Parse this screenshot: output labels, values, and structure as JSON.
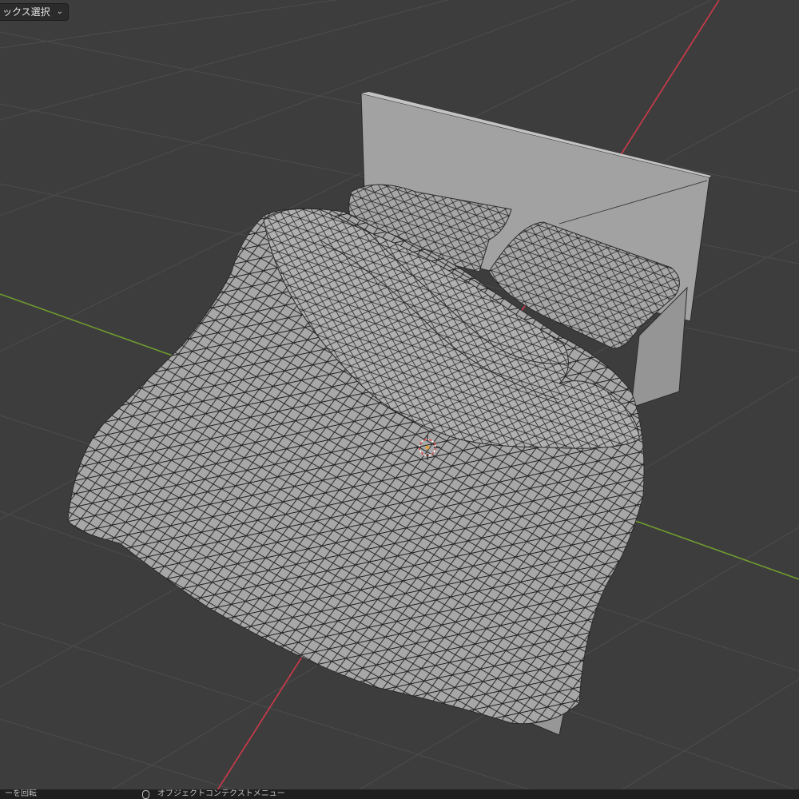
{
  "header": {
    "select_mode_label": "ックス選択",
    "chevron_icon": "chevron-down-icon"
  },
  "viewport": {
    "background_color": "#3d3d3d",
    "grid_color": "#4a4a4a",
    "x_axis_color": "#cf3a4a",
    "y_axis_color": "#6f9a2f",
    "mesh_color": "#a5a5a5",
    "wire_color": "#1a1a1a",
    "cursor_icon": "3d-cursor-icon"
  },
  "statusbar": {
    "left_hint": "ーを回転",
    "mouse_icon": "mouse-right-icon",
    "mid_hint": "オブジェクトコンテクストメニュー"
  }
}
